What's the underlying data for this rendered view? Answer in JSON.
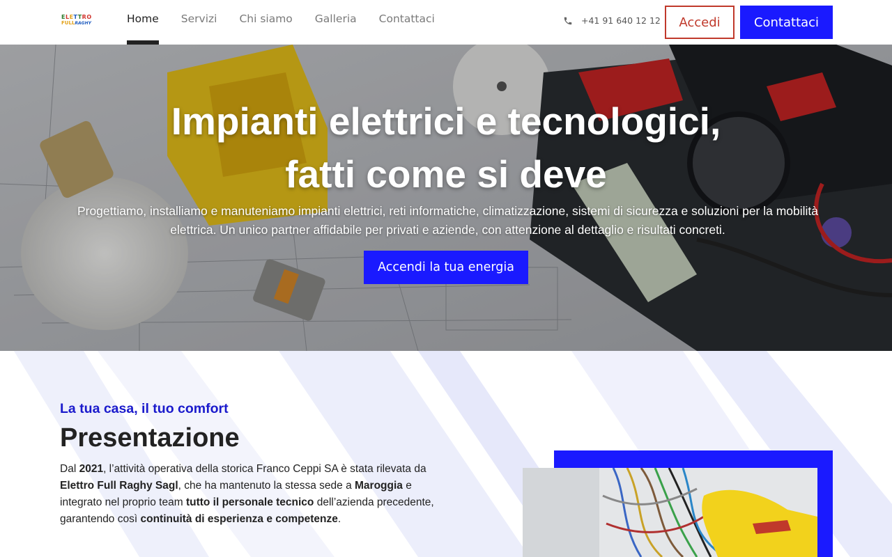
{
  "header": {
    "logo": {
      "line1": [
        "E",
        "L",
        "E",
        "T",
        "T",
        "RO"
      ],
      "line2_full": "FULL",
      "line2_brand": "RAGHY"
    },
    "nav": [
      {
        "label": "Home",
        "active": true
      },
      {
        "label": "Servizi",
        "active": false
      },
      {
        "label": "Chi siamo",
        "active": false
      },
      {
        "label": "Galleria",
        "active": false
      },
      {
        "label": "Contattaci",
        "active": false
      }
    ],
    "phone_icon": "phone-icon",
    "phone": "+41 91 640 12 12",
    "login_label": "Accedi",
    "contact_label": "Contattaci"
  },
  "hero": {
    "title_line1": "Impianti elettrici e tecnologici,",
    "title_line2": "fatti come si deve",
    "subtitle": "Progettiamo, installiamo e manuteniamo impianti elettrici, reti informatiche, climatizzazione, sistemi di sicurezza e soluzioni per la mobilità elettrica. Un unico partner affidabile per privati e aziende, con attenzione al dettaglio e risultati concreti.",
    "cta_label": "Accendi la tua energia"
  },
  "presentation": {
    "eyebrow": "La tua casa, il tuo comfort",
    "title": "Presentazione",
    "p_1": "Dal ",
    "p_2": "2021",
    "p_3": ", l’attività operativa della storica Franco Ceppi SA è stata rilevata da ",
    "p_4": "Elettro Full Raghy Sagl",
    "p_5": ", che ha mantenuto la stessa sede a ",
    "p_6": "Maroggia",
    "p_7": " e integrato nel proprio team ",
    "p_8": "tutto il personale tecnico",
    "p_9": " dell’azienda precedente, garantendo così ",
    "p_10": "continuità di esperienza e competenze",
    "p_11": "."
  },
  "colors": {
    "accent_blue": "#1a1aff",
    "eyebrow_blue": "#1a1acc",
    "login_red": "#c0392b"
  }
}
